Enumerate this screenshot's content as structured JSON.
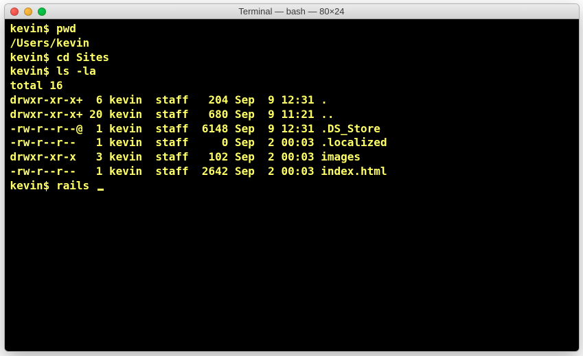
{
  "window": {
    "title": "Terminal — bash — 80×24"
  },
  "terminal": {
    "prompt": "kevin$",
    "lines": {
      "l0_prompt": "kevin$ ",
      "l0_cmd": "pwd",
      "l1": "/Users/kevin",
      "l2_prompt": "kevin$ ",
      "l2_cmd": "cd Sites",
      "l3_prompt": "kevin$ ",
      "l3_cmd": "ls -la",
      "l4": "total 16",
      "l5": "drwxr-xr-x+  6 kevin  staff   204 Sep  9 12:31 .",
      "l6": "drwxr-xr-x+ 20 kevin  staff   680 Sep  9 11:21 ..",
      "l7": "-rw-r--r--@  1 kevin  staff  6148 Sep  9 12:31 .DS_Store",
      "l8": "-rw-r--r--   1 kevin  staff     0 Sep  2 00:03 .localized",
      "l9": "drwxr-xr-x   3 kevin  staff   102 Sep  2 00:03 images",
      "l10": "-rw-r--r--   1 kevin  staff  2642 Sep  2 00:03 index.html",
      "l11_prompt": "kevin$ ",
      "l11_cmd": "rails "
    }
  }
}
